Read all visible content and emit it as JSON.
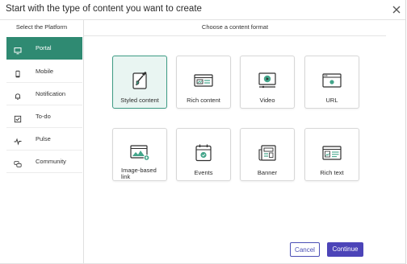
{
  "dialog": {
    "title": "Start with the type of content you want to create",
    "close_icon": "close-icon"
  },
  "sidebar": {
    "heading": "Select the Platform",
    "items": [
      {
        "label": "Portal",
        "icon": "monitor-icon",
        "active": true
      },
      {
        "label": "Mobile",
        "icon": "mobile-phone-icon",
        "active": false
      },
      {
        "label": "Notification",
        "icon": "bell-icon",
        "active": false
      },
      {
        "label": "To-do",
        "icon": "checkbox-icon",
        "active": false
      },
      {
        "label": "Pulse",
        "icon": "pulse-icon",
        "active": false
      },
      {
        "label": "Community",
        "icon": "chat-bubbles-icon",
        "active": false
      }
    ]
  },
  "main": {
    "heading": "Choose a content format",
    "formats": [
      {
        "label": "Styled content",
        "icon": "paint-brush-icon",
        "selected": true
      },
      {
        "label": "Rich content",
        "icon": "rich-content-icon",
        "selected": false
      },
      {
        "label": "Video",
        "icon": "video-player-icon",
        "selected": false
      },
      {
        "label": "URL",
        "icon": "url-window-icon",
        "selected": false
      },
      {
        "label": "Image-based link",
        "icon": "image-link-icon",
        "selected": false
      },
      {
        "label": "Events",
        "icon": "calendar-event-icon",
        "selected": false
      },
      {
        "label": "Banner",
        "icon": "banner-newspaper-icon",
        "selected": false
      },
      {
        "label": "Rich text",
        "icon": "rich-text-icon",
        "selected": false
      }
    ]
  },
  "footer": {
    "cancel_label": "Cancel",
    "continue_label": "Continue"
  },
  "colors": {
    "accent_green": "#2f8a72",
    "selected_card_bg": "#e9f5f2",
    "primary_button": "#4c44b8",
    "cancel_border": "#4a4fb5"
  }
}
